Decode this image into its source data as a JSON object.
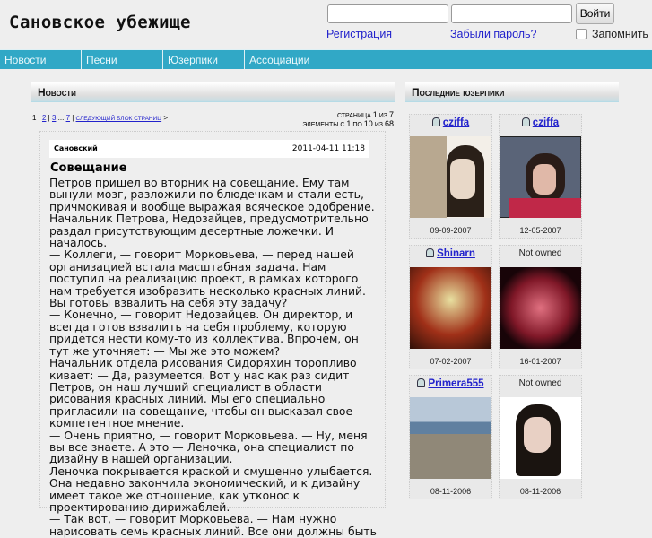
{
  "site": {
    "title": "Сановское убежище"
  },
  "login": {
    "button": "Войти",
    "register": "Регистрация",
    "forgot": "Забыли пароль?",
    "remember": "Запомнить"
  },
  "nav": [
    "Новости",
    "Песни",
    "Юзерпики",
    "Ассоциации"
  ],
  "news": {
    "header": "Новости",
    "pager": {
      "current": "1",
      "pages": [
        "2",
        "3",
        "7"
      ],
      "ellipsis": "...",
      "next": "следующий блок страниц",
      "page_label": "страница",
      "page": "1",
      "of": "из",
      "total_pages": "7",
      "items_label": "элементы с",
      "from": "1",
      "to_label": "по",
      "to": "10",
      "of2": "из",
      "total": "68"
    },
    "article": {
      "author": "Сановский",
      "date": "2011-04-11 11:18",
      "title": "Совещание",
      "paragraphs": [
        "Петров пришел во вторник на совещание. Ему там вынули мозг, разложили по блюдечкам и стали есть, причмокивая и вообще выражая всяческое одобрение. Начальник Петрова, Недозайцев, предусмотрительно раздал присутствующим десертные ложечки. И началось.",
        "— Коллеги, — говорит Морковьева, — перед нашей организацией встала масштабная задача. Нам поступил на реализацию проект, в рамках которого нам требуется изобразить несколько красных линий. Вы готовы взвалить на себя эту задачу?",
        "— Конечно, — говорит Недозайцев. Он директор, и всегда готов взвалить на себя проблему, которую придется нести кому-то из коллектива. Впрочем, он тут же уточняет: — Мы же это можем?",
        "Начальник отдела рисования Сидоряхин торопливо кивает: — Да, разумеется. Вот у нас как раз сидит Петров, он наш лучший специалист в области рисования красных линий. Мы его специально пригласили на совещание, чтобы он высказал свое компетентное мнение.",
        "— Очень приятно, — говорит Морковьева. — Ну, меня вы все знаете. А это — Леночка, она специалист по дизайну в нашей организации.",
        "Леночка покрывается краской и смущенно улыбается. Она недавно закончила экономический, и к дизайну имеет такое же отношение, как утконос к проектированию дирижаблей.",
        "— Так вот, — говорит Морковьева. — Нам нужно нарисовать семь красных линий. Все они должны быть"
      ]
    }
  },
  "userpics": {
    "header": "Последние юзерпики",
    "items": [
      {
        "user": "cziffa",
        "date": "09-09-2007"
      },
      {
        "user": "cziffa",
        "date": "12-05-2007"
      },
      {
        "user": "Shinarn",
        "date": "07-02-2007"
      },
      {
        "user": "Not owned",
        "date": "16-01-2007"
      },
      {
        "user": "Primera555",
        "date": "08-11-2006"
      },
      {
        "user": "Not owned",
        "date": "08-11-2006"
      }
    ]
  }
}
